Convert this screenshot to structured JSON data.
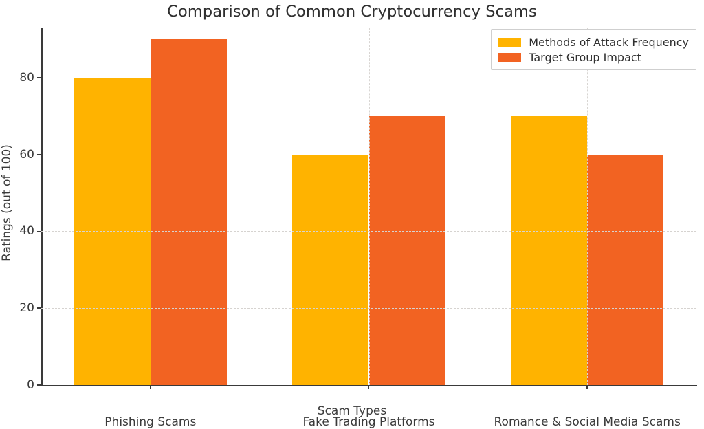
{
  "chart_data": {
    "type": "bar",
    "title": "Comparison of Common Cryptocurrency Scams",
    "xlabel": "Scam Types",
    "ylabel": "Ratings (out of 100)",
    "categories": [
      "Phishing Scams",
      "Fake Trading Platforms",
      "Romance & Social Media Scams"
    ],
    "series": [
      {
        "name": "Methods of Attack Frequency",
        "color": "#FFB300",
        "values": [
          80,
          60,
          70
        ]
      },
      {
        "name": "Target Group Impact",
        "color": "#F26322",
        "values": [
          90,
          70,
          60
        ]
      }
    ],
    "yticks": [
      0,
      20,
      40,
      60,
      80
    ],
    "ytick_labels": [
      "0",
      "20",
      "40",
      "60",
      "80"
    ],
    "ylim": [
      0,
      93
    ],
    "grid": true,
    "grid_style": "dashed",
    "grid_color": "#d6d3d0",
    "legend_position": "upper right",
    "bar_width_fraction": 0.35
  }
}
